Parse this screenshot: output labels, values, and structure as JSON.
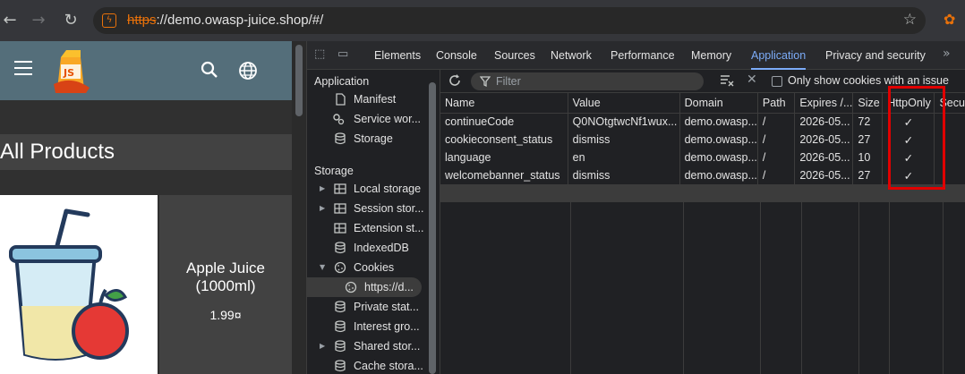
{
  "browser": {
    "url_protocol": "https",
    "url_rest": "://demo.owasp-juice.shop/#/"
  },
  "page": {
    "heading": "All Products",
    "product": {
      "name": "Apple Juice (1000ml)",
      "price": "1.99¤"
    }
  },
  "devtools": {
    "tabs": [
      "Elements",
      "Console",
      "Sources",
      "Network",
      "Performance",
      "Memory",
      "Application",
      "Privacy and security"
    ],
    "active_tab": "Application",
    "sidebar": {
      "section_application": "Application",
      "app_items": [
        "Manifest",
        "Service wor...",
        "Storage"
      ],
      "section_storage": "Storage",
      "storage_items": [
        "Local storage",
        "Session stor...",
        "Extension st...",
        "IndexedDB",
        "Cookies",
        "https://d...",
        "Private stat...",
        "Interest gro...",
        "Shared stor...",
        "Cache stora..."
      ]
    },
    "filter_placeholder": "Filter",
    "issue_checkbox_label": "Only show cookies with an issue",
    "columns": [
      "Name",
      "Value",
      "Domain",
      "Path",
      "Expires /...",
      "Size",
      "HttpOnly",
      "Secu"
    ],
    "rows": [
      {
        "name": "continueCode",
        "value": "Q0NOtgtwcNf1wux...",
        "domain": "demo.owasp...",
        "path": "/",
        "expires": "2026-05...",
        "size": "72",
        "httponly": "✓"
      },
      {
        "name": "cookieconsent_status",
        "value": "dismiss",
        "domain": "demo.owasp...",
        "path": "/",
        "expires": "2026-05...",
        "size": "27",
        "httponly": "✓"
      },
      {
        "name": "language",
        "value": "en",
        "domain": "demo.owasp...",
        "path": "/",
        "expires": "2026-05...",
        "size": "10",
        "httponly": "✓"
      },
      {
        "name": "welcomebanner_status",
        "value": "dismiss",
        "domain": "demo.owasp...",
        "path": "/",
        "expires": "2026-05...",
        "size": "27",
        "httponly": "✓"
      }
    ],
    "highlight_color": "#e00000",
    "accent_color": "#7cacf8"
  }
}
